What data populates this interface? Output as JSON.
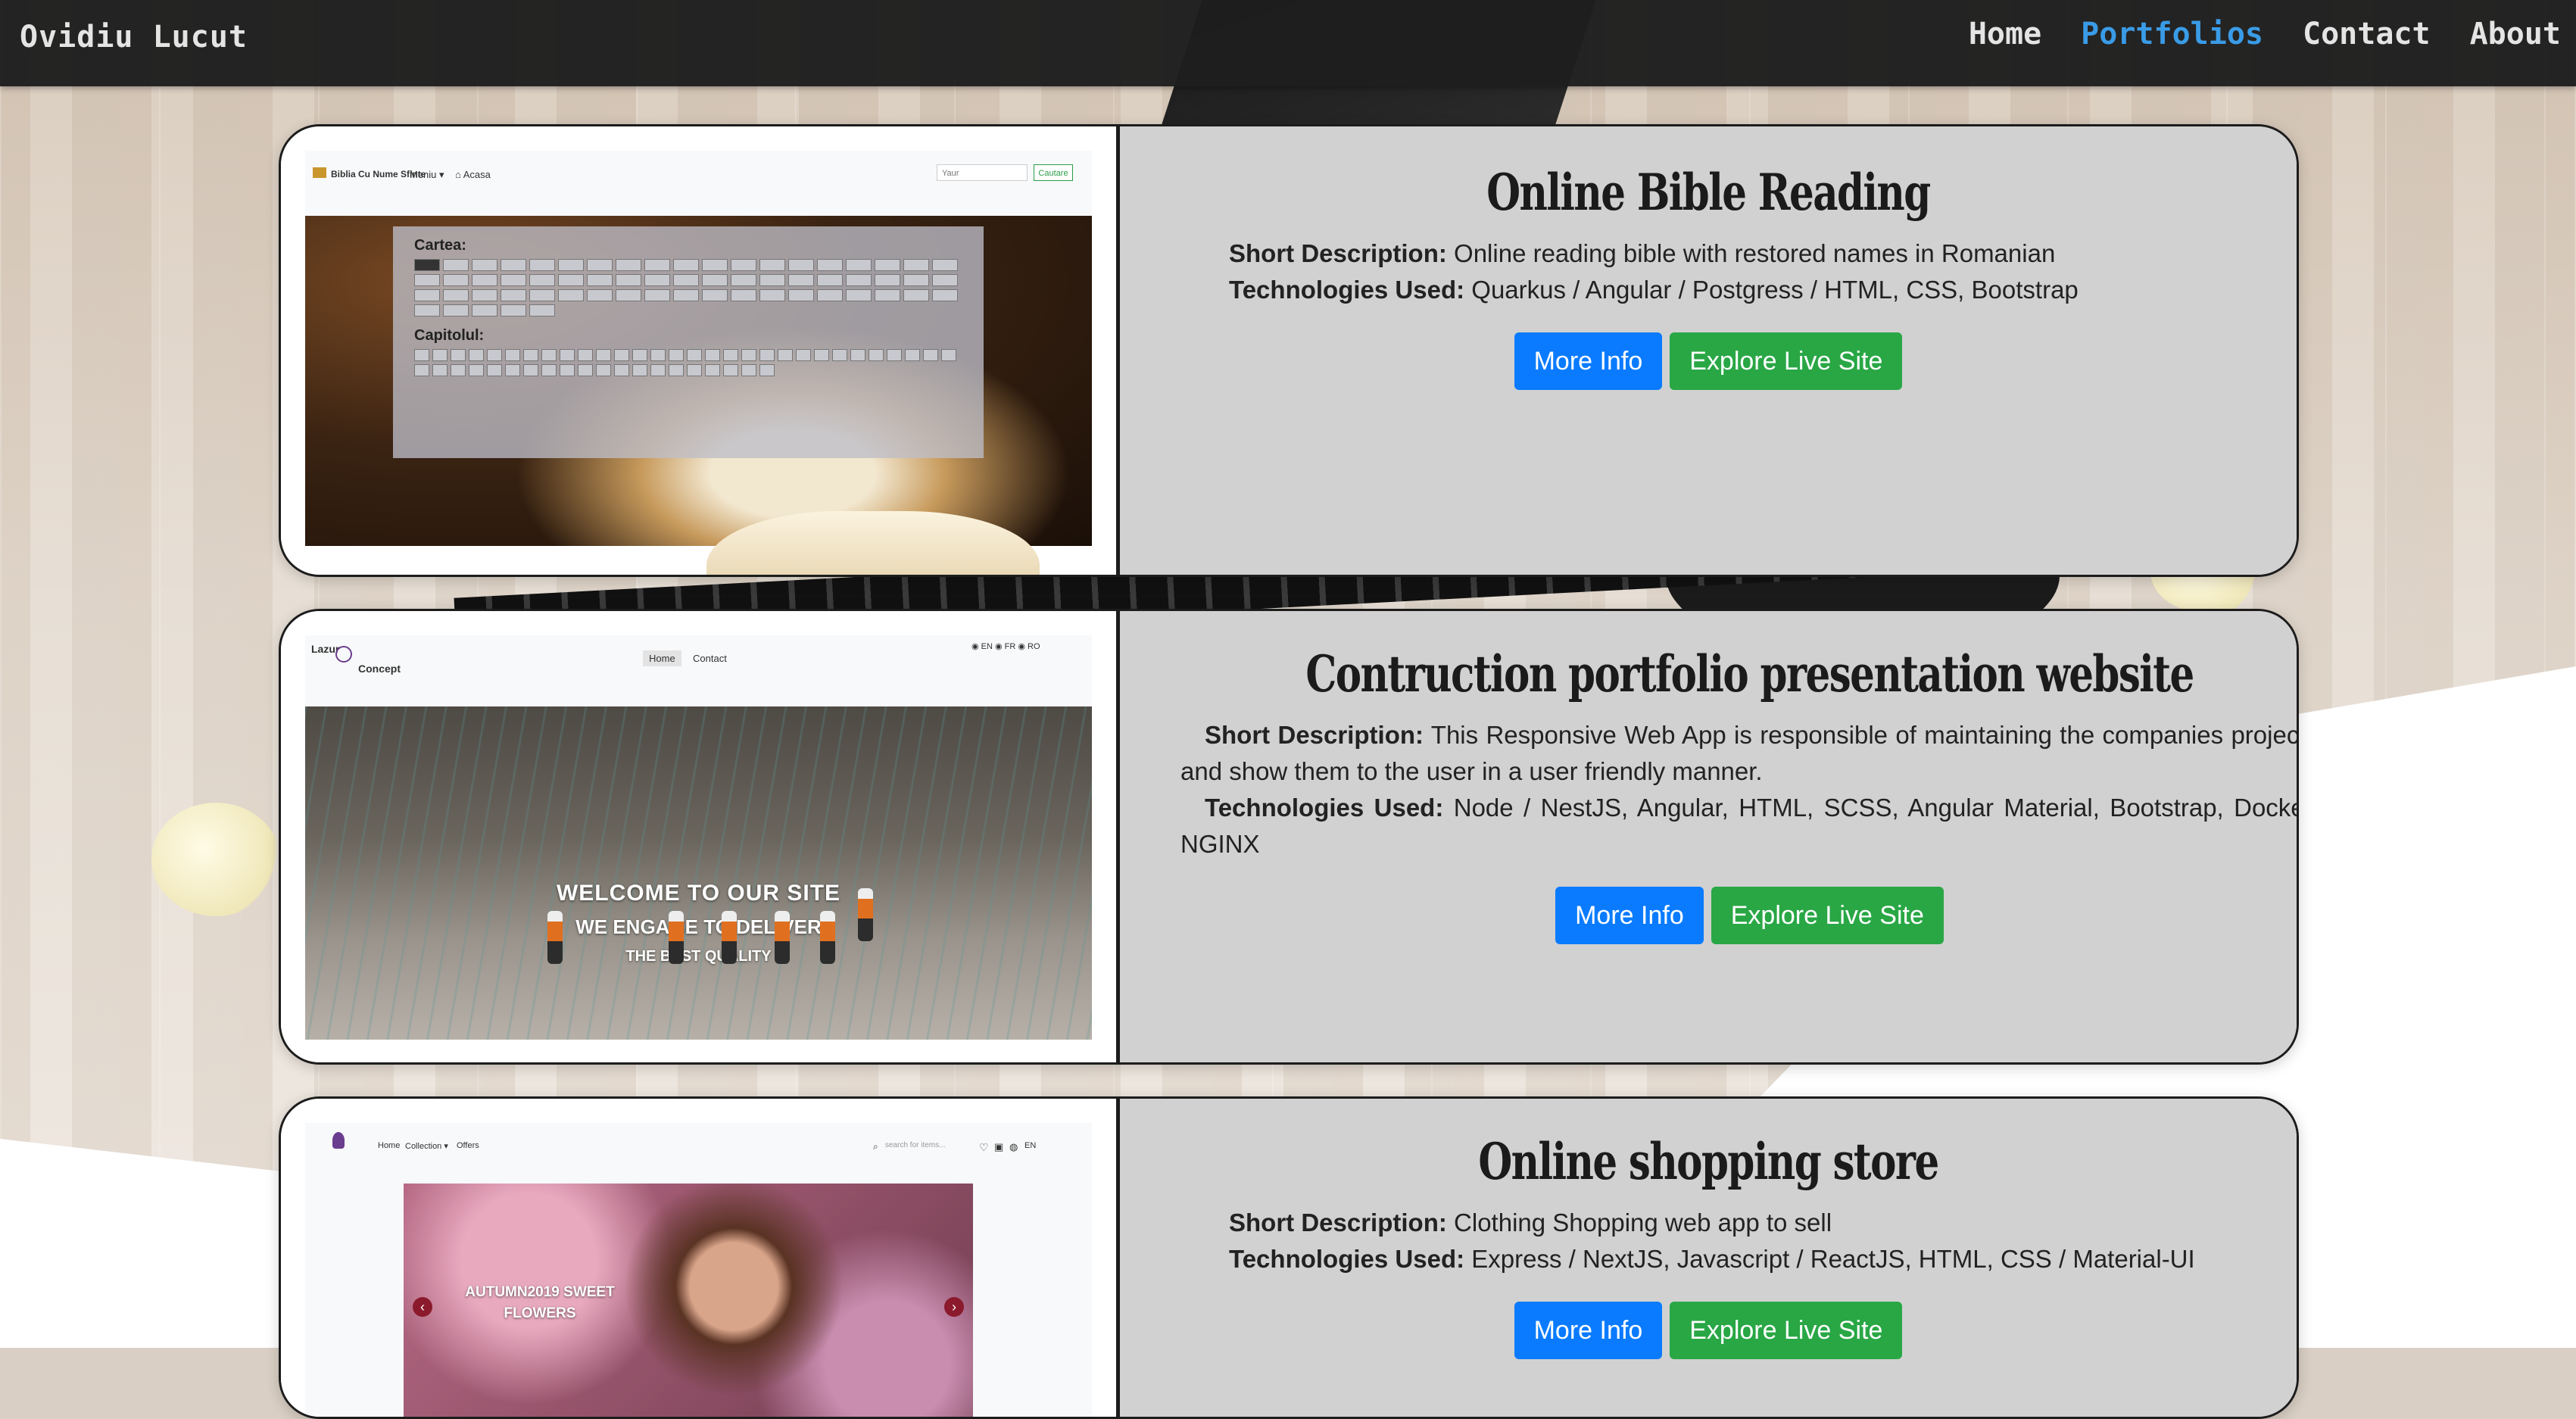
{
  "navbar": {
    "brand": "Ovidiu Lucut",
    "links": [
      {
        "label": "Home",
        "active": false
      },
      {
        "label": "Portfolios",
        "active": true
      },
      {
        "label": "Contact",
        "active": false
      },
      {
        "label": "About",
        "active": false
      }
    ],
    "active_color": "#3a9be6"
  },
  "labels": {
    "short_description": "Short Description:",
    "technologies_used": "Technologies Used:",
    "more_info": "More Info",
    "explore_live_site": "Explore Live Site"
  },
  "colors": {
    "more_info_button": "#0a7bff",
    "explore_button": "#29a745",
    "card_panel": "#d1d1d1"
  },
  "portfolios": [
    {
      "title": "Online Bible Reading",
      "short_description": "Online reading bible with restored names in Romanian",
      "technologies": "Quarkus / Angular / Postgress / HTML, CSS, Bootstrap",
      "preview": {
        "site_title": "Biblia Cu Nume Sfinte",
        "menu": "Meniu ▾",
        "home": "⌂ Acasa",
        "search_placeholder": "Yaur",
        "search_button": "Cautare",
        "book_heading": "Cartea:",
        "chapter_heading": "Capitolul:"
      }
    },
    {
      "title": "Contruction portfolio presentation website",
      "short_description": "This Responsive Web App is responsible of maintaining the companies projects and show them to the user in a user friendly manner.",
      "technologies": "Node / NestJS, Angular, HTML, SCSS, Angular Material, Bootstrap, Docker, NGINX",
      "preview": {
        "logo_top": "Lazur",
        "logo_bottom": "Concept",
        "nav_home": "Home",
        "nav_contact": "Contact",
        "langs": "◉ EN   ◉ FR   ◉ RO",
        "line1": "WELCOME TO OUR SITE",
        "line2": "WE ENGAGE TO DELIVER",
        "line3": "THE BEST QUALITY"
      }
    },
    {
      "title": "Online shopping store",
      "short_description": "Clothing Shopping web app to sell",
      "technologies": "Express / NextJS, Javascript / ReactJS, HTML, CSS / Material-UI",
      "preview": {
        "nav_home": "Home",
        "nav_collection": "Collection ▾",
        "nav_offers": "Offers",
        "search_placeholder": "search for items...",
        "lang": "EN",
        "caption": "AUTUMN2019 SWEET FLOWERS"
      }
    }
  ]
}
